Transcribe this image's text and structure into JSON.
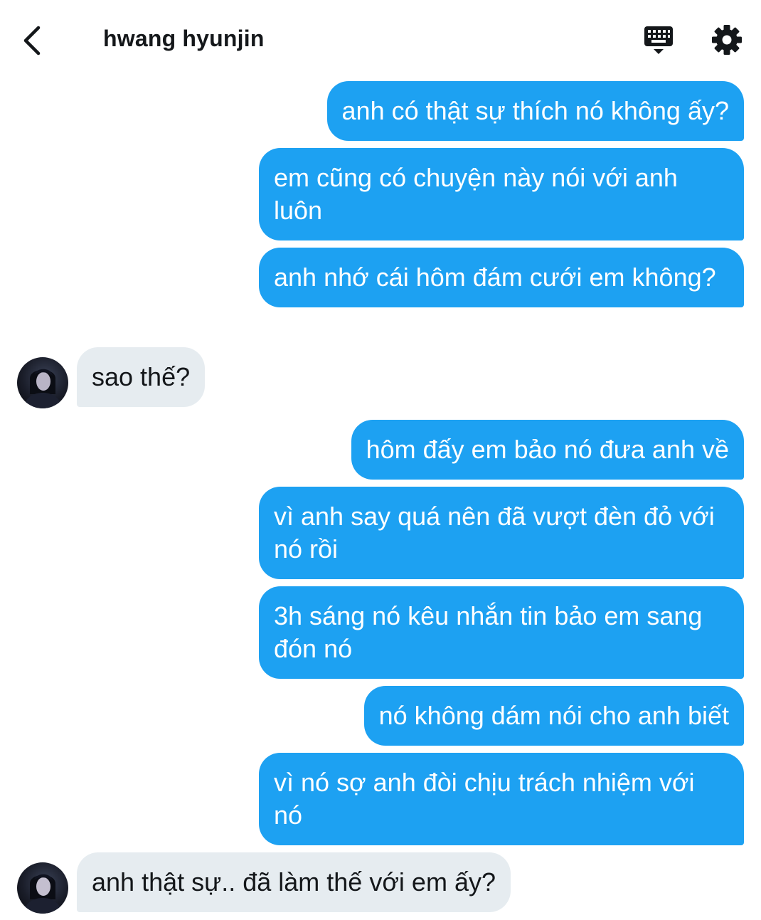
{
  "header": {
    "title": "hwang hyunjin",
    "back_icon": "chevron-left-icon",
    "keyboard_icon": "keyboard-icon",
    "settings_icon": "gear-icon"
  },
  "colors": {
    "sent_bubble": "#1da1f2",
    "received_bubble": "#e6ecf0",
    "text_dark": "#14171a"
  },
  "messages": [
    {
      "direction": "sent",
      "text": "anh có thật sự thích nó không ấy?"
    },
    {
      "direction": "sent",
      "text": "em cũng có chuyện này nói với anh luôn"
    },
    {
      "direction": "sent",
      "text": "anh nhớ cái hôm đám cưới em không?"
    },
    {
      "direction": "received",
      "text": "sao thế?"
    },
    {
      "direction": "sent",
      "text": "hôm đấy em bảo nó đưa anh về"
    },
    {
      "direction": "sent",
      "text": "vì anh say quá nên đã vượt đèn đỏ với nó rồi"
    },
    {
      "direction": "sent",
      "text": "3h sáng nó kêu nhắn tin bảo em sang đón nó"
    },
    {
      "direction": "sent",
      "text": "nó không dám nói cho anh biết"
    },
    {
      "direction": "sent",
      "text": "vì nó sợ anh đòi chịu trách nhiệm với nó"
    },
    {
      "direction": "received",
      "text": "anh thật sự.. đã làm thế với em ấy?"
    }
  ]
}
